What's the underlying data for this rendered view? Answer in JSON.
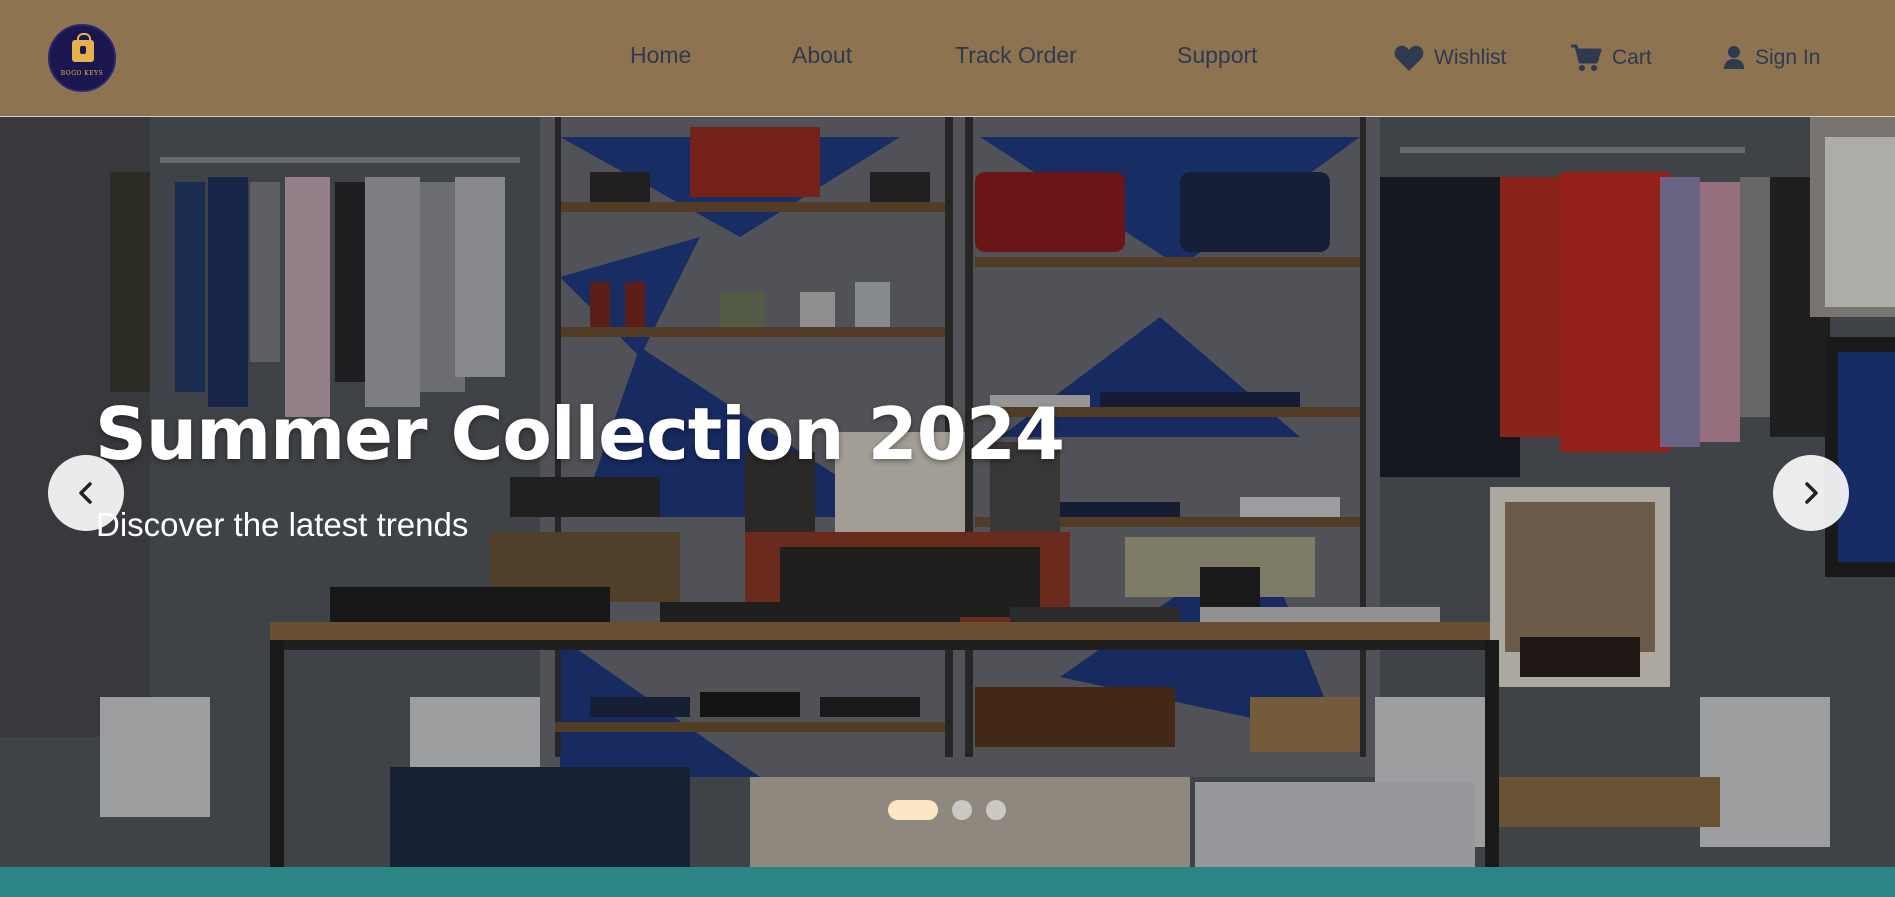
{
  "header": {
    "logo": {
      "text": "BOGO KEYS",
      "icon": "shopping-bag-icon"
    },
    "nav": [
      {
        "label": "Home"
      },
      {
        "label": "About"
      },
      {
        "label": "Track Order"
      },
      {
        "label": "Support"
      }
    ],
    "actions": {
      "wishlist": {
        "label": "Wishlist",
        "icon": "heart-icon"
      },
      "cart": {
        "label": "Cart",
        "icon": "cart-icon"
      },
      "signin": {
        "label": "Sign In",
        "icon": "user-icon"
      }
    }
  },
  "hero": {
    "title": "Summer Collection 2024",
    "subtitle": "Discover the latest trends",
    "prev_icon": "chevron-left-icon",
    "next_icon": "chevron-right-icon",
    "slides_total": 3,
    "active_slide": 1
  },
  "colors": {
    "header_bg": "#8e7351",
    "nav_text": "#2e3a50",
    "accent_teal": "#2a8584",
    "active_dot": "#fde6c4",
    "logo_bg": "#1a1650"
  }
}
